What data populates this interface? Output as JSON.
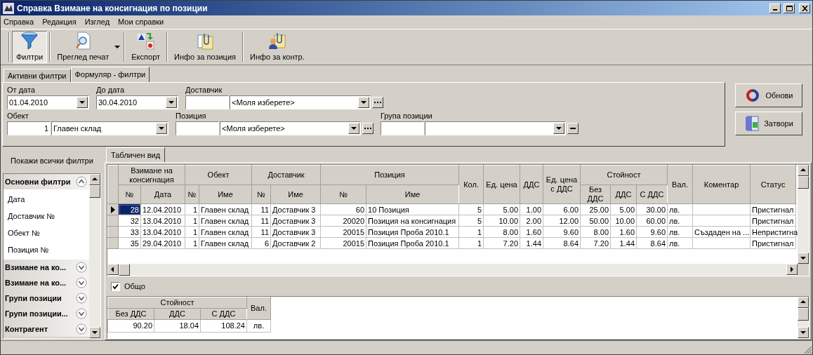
{
  "window": {
    "title": "Справка Взимане на консигнация по позиции"
  },
  "menu": [
    "Справка",
    "Редакция",
    "Изглед",
    "Мои справки"
  ],
  "toolbar": [
    {
      "label": "Филтри",
      "pressed": true,
      "has_menu": false
    },
    {
      "label": "Преглед печат",
      "pressed": false,
      "has_menu": true
    },
    {
      "label": "Експорт",
      "pressed": false,
      "has_menu": false
    },
    {
      "label": "Инфо за позиция",
      "pressed": false,
      "has_menu": false
    },
    {
      "label": "Инфо за контр.",
      "pressed": false,
      "has_menu": false
    }
  ],
  "filter_tabs": [
    {
      "label": "Активни филтри",
      "selected": false
    },
    {
      "label": "Формуляр - филтри",
      "selected": true
    }
  ],
  "filter_rows": [
    [
      {
        "kind": "date",
        "label": "От дата",
        "value": "01.04.2010"
      },
      {
        "kind": "date",
        "label": "До дата",
        "value": "30.04.2010"
      },
      {
        "kind": "lookup",
        "label": "Доставчик",
        "value": "<Моля изберете>"
      }
    ],
    [
      {
        "kind": "combo",
        "label": "Обект",
        "code": "1",
        "value": "Главен склад"
      },
      {
        "kind": "lookup",
        "label": "Позиция",
        "value": "<Моля изберете>"
      },
      {
        "kind": "group",
        "label": "Група позиции"
      }
    ]
  ],
  "actions": [
    "Обнови",
    "Затвори"
  ],
  "show_all_filters": "Покажи всички филтри",
  "filter_groups": [
    {
      "label": "Основни филтри",
      "expanded": true,
      "items": [
        "Дата",
        "Доставчик №",
        "Обект №",
        "Позиция №"
      ]
    },
    {
      "label": "Взимане на ко...",
      "expanded": false
    },
    {
      "label": "Взимане на ко...",
      "expanded": false
    },
    {
      "label": "Групи позиции",
      "expanded": false
    },
    {
      "label": "Групи позиции...",
      "expanded": false
    },
    {
      "label": "Контрагент",
      "expanded": false
    }
  ],
  "view_tabs": [
    {
      "label": "Табличен вид",
      "selected": true
    }
  ],
  "table": {
    "header": [
      {
        "label": "Взимане на консигнация",
        "columns": [
          "№",
          "Дата"
        ]
      },
      {
        "label": "Обект",
        "columns": [
          "№",
          "Име"
        ]
      },
      {
        "label": "Доставчик",
        "columns": [
          "№",
          "Име"
        ]
      },
      {
        "label": "Позиция",
        "columns": [
          "№",
          "Име"
        ]
      },
      {
        "label": "Кол."
      },
      {
        "label": "Ед. цена"
      },
      {
        "label": "ДДС"
      },
      {
        "label": "Ед. цена с ДДС"
      },
      {
        "label": "Стойност",
        "columns": [
          "Без ДДС",
          "ДДС",
          "С ДДС"
        ]
      },
      {
        "label": "Вал."
      },
      {
        "label": "Коментар"
      },
      {
        "label": "Статус"
      }
    ],
    "rows": [
      {
        "selected": true,
        "cells": [
          "28",
          "12.04.2010",
          "1",
          "Главен склад",
          "11",
          "Доставчик 3",
          "60",
          "10 Позиция",
          "5",
          "5.00",
          "1.00",
          "6.00",
          "25.00",
          "5.00",
          "30.00",
          "лв.",
          "",
          "Пристигнал"
        ]
      },
      {
        "selected": false,
        "cells": [
          "32",
          "13.04.2010",
          "1",
          "Главен склад",
          "11",
          "Доставчик 3",
          "20020",
          "Позиция на консигнация",
          "5",
          "10.00",
          "2.00",
          "12.00",
          "50.00",
          "10.00",
          "60.00",
          "лв.",
          "",
          "Пристигнал"
        ]
      },
      {
        "selected": false,
        "cells": [
          "33",
          "13.04.2010",
          "1",
          "Главен склад",
          "11",
          "Доставчик 3",
          "20015",
          "Позиция Проба 2010.1",
          "1",
          "8.00",
          "1.60",
          "9.60",
          "8.00",
          "1.60",
          "9.60",
          "лв.",
          "Създаден на ...",
          "Непристигна"
        ]
      },
      {
        "selected": false,
        "cells": [
          "35",
          "29.04.2010",
          "1",
          "Главен склад",
          "6",
          "Доставчик 2",
          "20015",
          "Позиция Проба 2010.1",
          "1",
          "7.20",
          "1.44",
          "8.64",
          "7.20",
          "1.44",
          "8.64",
          "лв.",
          "",
          "Пристигнал"
        ]
      }
    ]
  },
  "total_toggle": {
    "label": "Общо",
    "checked": true
  },
  "totals": {
    "header": [
      {
        "label": "Стойност",
        "columns": [
          "Без ДДС",
          "ДДС",
          "С ДДС"
        ]
      },
      {
        "label": "Вал."
      }
    ],
    "row": [
      "90.20",
      "18.04",
      "108.24",
      "лв."
    ]
  }
}
